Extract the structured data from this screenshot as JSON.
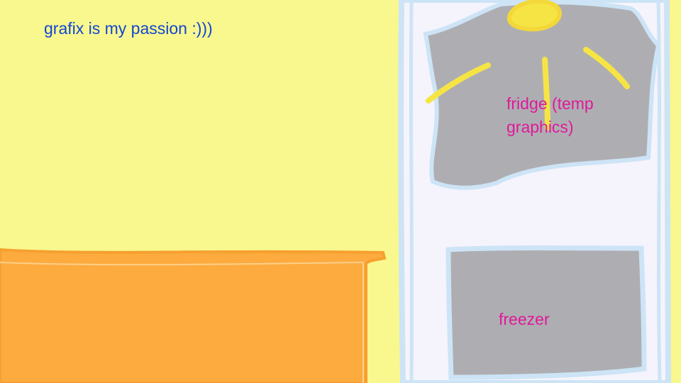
{
  "scene": {
    "caption": "grafix is my passion :)))",
    "fridge": {
      "label": "fridge (temp graphics)"
    },
    "freezer": {
      "label": "freezer"
    }
  },
  "colors": {
    "wall": "#f8f88e",
    "counter": "#fdaa3e",
    "appliance_body": "#f5f4fc",
    "appliance_outline": "#cde4f6",
    "compartment": "#aeaeb2",
    "light": "#f6e445",
    "caption_text": "#1446d2",
    "label_text": "#e0199a"
  }
}
